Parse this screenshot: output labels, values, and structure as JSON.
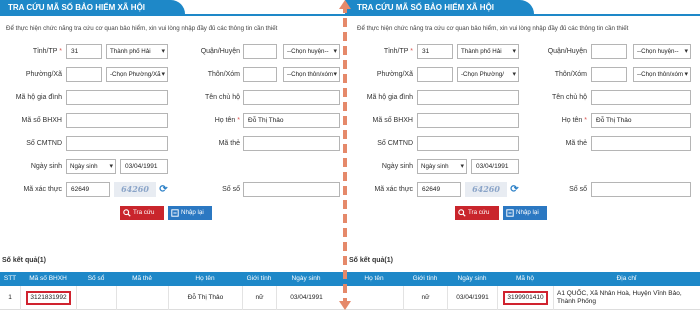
{
  "title": "TRA CỨU MÃ SỐ BẢO HIỂM XÃ HỘI",
  "intro": "Để thực hiện chức năng tra cứu cơ quan bảo hiểm, xin vui lòng nhập đầy đủ các thông tin cần thiết",
  "required_mark": "*",
  "form": {
    "province_label": "Tỉnh/TP",
    "province_code": "31",
    "province_select": "Thành phố Hải",
    "district_label": "Quận/Huyện",
    "district_select": "--Chọn huyện--",
    "ward_label": "Phường/Xã",
    "ward_select_left": "-Chọn Phường/Xã",
    "ward_select_right": "-Chọn Phường/",
    "hamlet_label": "Thôn/Xóm",
    "hamlet_select": "--Chọn thôn/xóm",
    "household_code_label": "Mã hộ gia đình",
    "household_head_label": "Tên chủ hộ",
    "bhxh_code_label": "Mã số BHXH",
    "fullname_label": "Họ tên",
    "fullname_value": "Đỗ Thị Thảo",
    "id_card_label": "Số CMTND",
    "card_code_label": "Mã thẻ",
    "dob_label": "Ngày sinh",
    "dob_type_select": "Ngày sinh",
    "dob_value": "03/04/1991",
    "captcha_label": "Mã xác thực",
    "captcha_value": "62649",
    "captcha_image_text": "64260",
    "book_no_label": "Số sổ"
  },
  "buttons": {
    "search": "Tra cứu",
    "reset": "Nhập lại"
  },
  "results": {
    "label": "Số kết quả(1)",
    "left_columns": [
      "STT",
      "Mã số BHXH",
      "Số sổ",
      "Mã thẻ",
      "Họ tên",
      "Giới tính",
      "Ngày sinh"
    ],
    "left_row": [
      "1",
      "3121831992",
      "",
      "",
      "Đỗ Thị Thảo",
      "nữ",
      "03/04/1991"
    ],
    "right_columns": [
      "Họ tên",
      "Giới tính",
      "Ngày sinh",
      "Mã hộ",
      "Địa chỉ"
    ],
    "right_row": [
      "",
      "nữ",
      "03/04/1991",
      "3199901410",
      "A1 QUỐC, Xã Nhân Hoà, Huyện Vĩnh Bảo, Thành Phống"
    ]
  },
  "colors": {
    "accent": "#1e88c8",
    "search_button": "#c9252c",
    "reset_button": "#2b78c2",
    "highlight": "#d0232f",
    "divider": "#e5896a"
  }
}
